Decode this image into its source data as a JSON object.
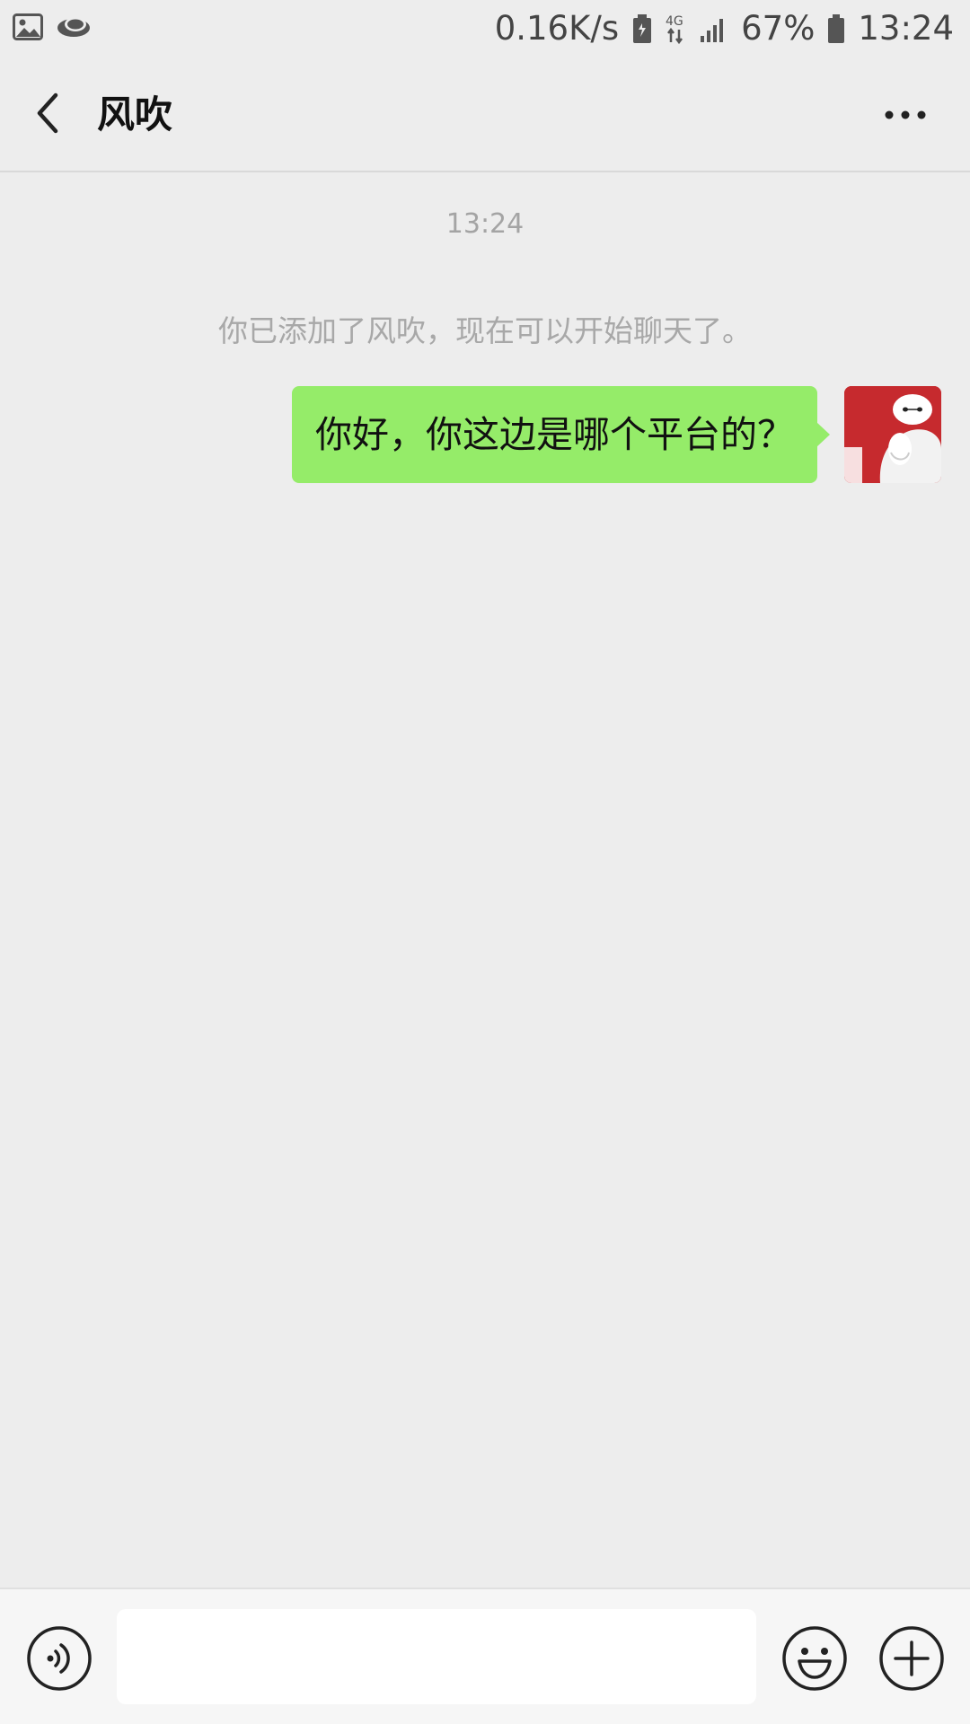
{
  "status_bar": {
    "left_icons": [
      "image-icon",
      "cloud-app-icon"
    ],
    "network_speed": "0.16K/s",
    "network_type": "4G",
    "battery_percent": "67%",
    "time": "13:24",
    "icons": [
      "battery-saver-icon",
      "4g-data-icon",
      "signal-icon",
      "battery-icon"
    ]
  },
  "header": {
    "title": "风吹",
    "back_icon": "chevron-left-icon",
    "more_icon": "more-dots-icon"
  },
  "chat": {
    "timestamp": "13:24",
    "system_message": "你已添加了风吹，现在可以开始聊天了。",
    "messages": [
      {
        "sender": "me",
        "text": "你好，你这边是哪个平台的？",
        "bubble_color": "#95ec69"
      }
    ]
  },
  "input_bar": {
    "voice_icon": "voice-input-icon",
    "text_value": "",
    "emoji_icon": "emoji-icon",
    "plus_icon": "plus-icon"
  },
  "colors": {
    "background": "#ededed",
    "bubble": "#95ec69",
    "avatar": "#c62a2e"
  }
}
